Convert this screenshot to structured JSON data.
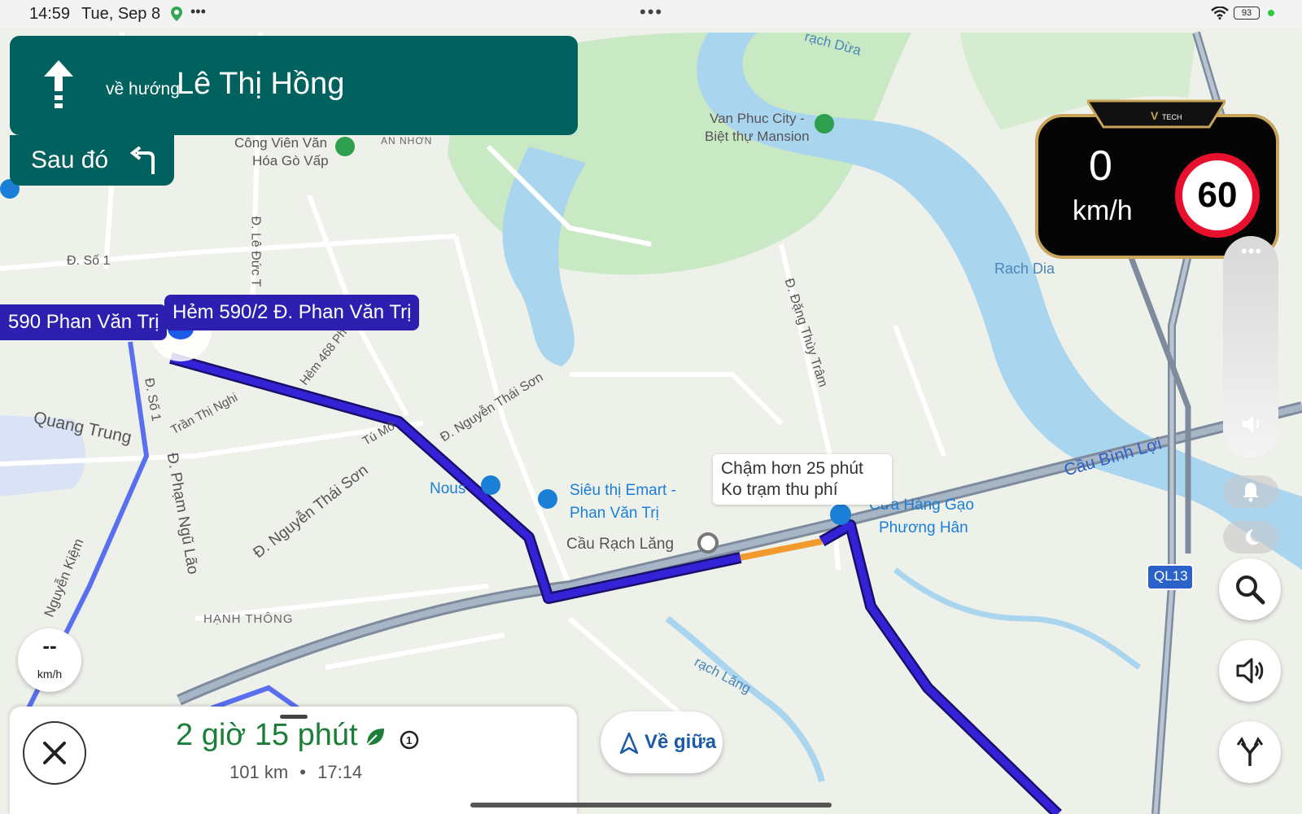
{
  "status_bar": {
    "time": "14:59",
    "date": "Tue, Sep 8",
    "center_dots": "•••",
    "battery": "93"
  },
  "navigation": {
    "toward_label": "về hướng",
    "street": "Lê Thị Hồng",
    "then_label": "Sau đó",
    "maneuver_icon": "arrow-up-icon",
    "next_maneuver_icon": "turn-left-icon"
  },
  "speed_widget": {
    "current_speed": "0",
    "unit": "km/h",
    "limit": "60"
  },
  "side_panel": {
    "more": "•••"
  },
  "route_labels": {
    "origin": "590 Phan Văn Trị",
    "destination_hint": "Hẻm 590/2 Đ. Phan Văn Trị"
  },
  "tooltip": {
    "line1": "Chậm hơn 25 phút",
    "line2": "Ko trạm thu phí"
  },
  "map_labels": {
    "park": "Công Viên Văn",
    "park2": "Hóa Gò Vấp",
    "an_nhon": "AN NHƠN",
    "van_phuc": "Van Phuc City -",
    "van_phuc2": "Biệt thự Mansion",
    "rach_dua": "rạch Dừa",
    "rach_dia": "Rach Dia",
    "le_duc": "Đ. Lê Đức T",
    "so1_top": "Đ. Số 1",
    "dang_thuy_tram": "Đ. Đặng Thùy Trâm",
    "hem468": "Hẻm 468 Ph",
    "nguyen_thai_son": "Đ. Nguyễn Thái Sơn",
    "nguyen_thai_son2": "Đ. Nguyễn Thái Sơn",
    "tran_thi_nghi": "Trần Thị Nghi",
    "tu_mo": "Tú Mỡ",
    "quang_trung": "Quang Trung",
    "so1": "Đ. Số 1",
    "pham_ngu_lao": "Đ. Phạm Ngũ Lão",
    "nguyen_kiem": "Nguyễn Kiệm",
    "hanh_thong": "HẠNH THÔNG",
    "nous": "Nous",
    "emart": "Siêu thị Emart -",
    "emart2": "Phan Văn Trị",
    "cau_rach_lang": "Cầu Rạch Lăng",
    "cau_hang_gao": "Cửa Hàng Gạo",
    "cau_hang_gao2": "Phương Hân",
    "cau_binh_loi": "Cầu Bình Lợi",
    "ql13": "QL13",
    "rach_lang": "rạch Lăng"
  },
  "bottom_card": {
    "duration": "2 giờ 15 phút",
    "distance": "101 km",
    "separator": "•",
    "eta": "17:14"
  },
  "recenter": {
    "label": "Về giữa"
  },
  "small_speed": {
    "value": "--",
    "unit": "km/h"
  },
  "colors": {
    "banner": "#01615f",
    "route": "#2d1fb0",
    "traffic": "#f29a2e",
    "duration_green": "#1b7f39",
    "speed_limit_red": "#e8112d",
    "water": "#a9d5ef",
    "park": "#c9e8c4"
  }
}
